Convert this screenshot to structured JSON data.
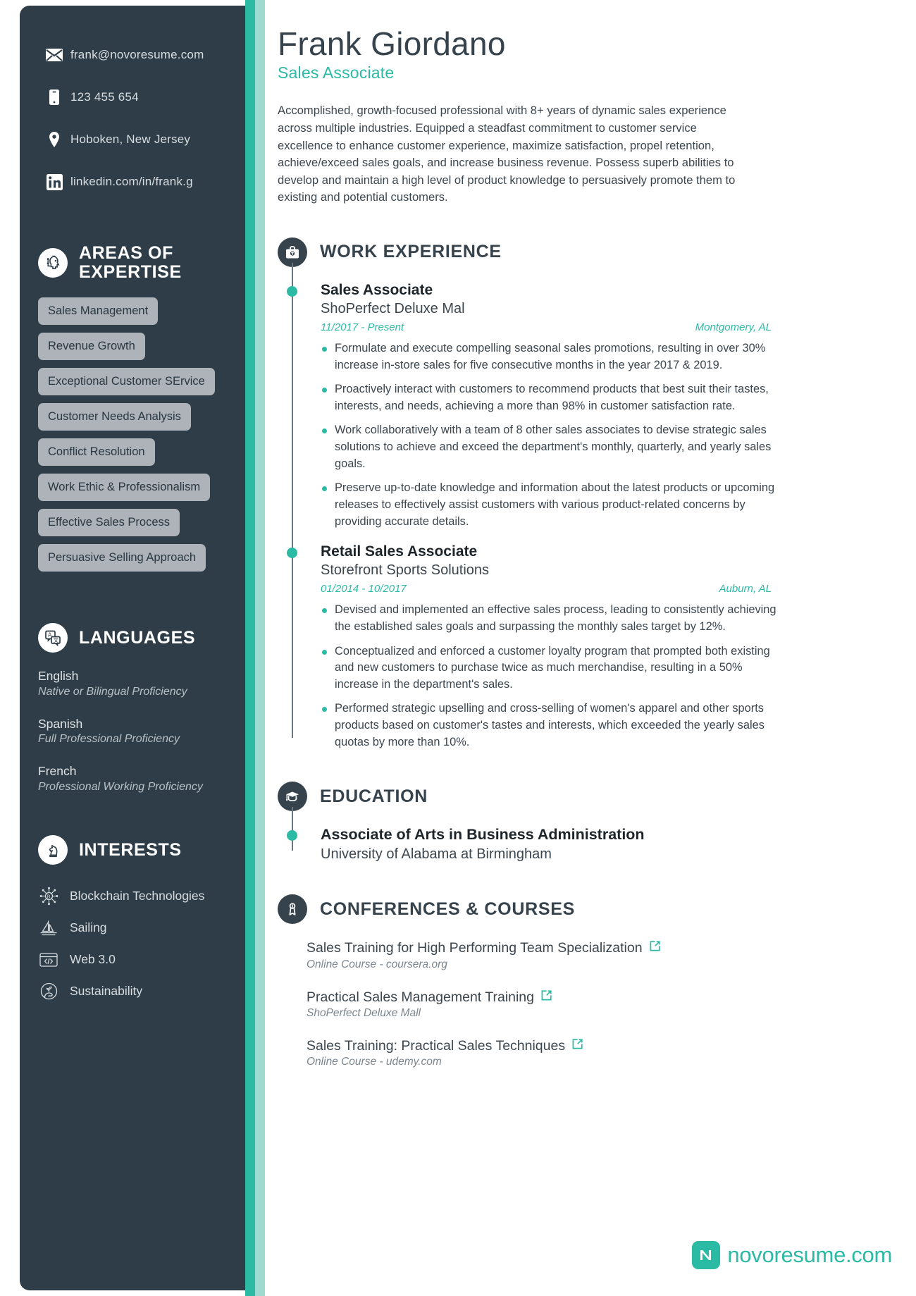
{
  "colors": {
    "accent": "#2bbaa4",
    "accent_light": "#9ddbd1",
    "dark": "#2e3d47",
    "heading": "#36434d"
  },
  "header": {
    "name": "Frank Giordano",
    "role": "Sales Associate",
    "summary": "Accomplished, growth-focused professional with 8+ years of dynamic sales experience across multiple industries. Equipped a steadfast commitment to customer service excellence to enhance customer experience, maximize satisfaction, propel retention, achieve/exceed sales goals, and increase business revenue. Possess superb abilities to develop and maintain a high level of product knowledge to persuasively promote them to existing and potential customers."
  },
  "sidebar": {
    "contacts": [
      {
        "icon": "envelope-icon",
        "value": "frank@novoresume.com"
      },
      {
        "icon": "phone-icon",
        "value": "123 455 654"
      },
      {
        "icon": "location-pin-icon",
        "value": "Hoboken, New Jersey"
      },
      {
        "icon": "linkedin-icon",
        "value": "linkedin.com/in/frank.g"
      }
    ],
    "expertise": {
      "icon": "brain-head-icon",
      "title_line1": "AREAS OF",
      "title_line2": "EXPERTISE",
      "tags": [
        "Sales Management",
        "Revenue Growth",
        "Exceptional Customer SErvice",
        "Customer Needs Analysis",
        "Conflict Resolution",
        "Work Ethic & Professionalism",
        "Effective Sales Process",
        "Persuasive Selling Approach"
      ]
    },
    "languages": {
      "icon": "translate-icon",
      "title": "LANGUAGES",
      "items": [
        {
          "name": "English",
          "level": "Native or Bilingual Proficiency"
        },
        {
          "name": "Spanish",
          "level": "Full Professional Proficiency"
        },
        {
          "name": "French",
          "level": "Professional Working Proficiency"
        }
      ]
    },
    "interests": {
      "icon": "chess-knight-icon",
      "title": "INTERESTS",
      "items": [
        {
          "icon": "blockchain-icon",
          "label": "Blockchain Technologies"
        },
        {
          "icon": "sailboat-icon",
          "label": "Sailing"
        },
        {
          "icon": "browser-code-icon",
          "label": "Web 3.0"
        },
        {
          "icon": "hand-plant-icon",
          "label": "Sustainability"
        }
      ]
    }
  },
  "work": {
    "icon": "briefcase-icon",
    "title": "WORK EXPERIENCE",
    "entries": [
      {
        "title": "Sales Associate",
        "org": "ShoPerfect Deluxe Mal",
        "dates": "11/2017 - Present",
        "location": "Montgomery, AL",
        "bullets": [
          "Formulate and execute compelling seasonal sales promotions, resulting in over 30% increase in-store sales for five consecutive months in the year 2017 & 2019.",
          "Proactively interact with customers to recommend products that best suit their tastes, interests, and needs, achieving a more than 98% in customer satisfaction rate.",
          "Work collaboratively with a team of 8 other sales associates to devise strategic sales solutions to achieve and exceed the department's monthly, quarterly, and yearly sales goals.",
          "Preserve up-to-date knowledge and information about the latest products or upcoming releases to effectively assist customers with various product-related concerns by providing accurate details."
        ]
      },
      {
        "title": "Retail Sales Associate",
        "org": "Storefront Sports Solutions",
        "dates": "01/2014 - 10/2017",
        "location": "Auburn, AL",
        "bullets": [
          "Devised and implemented an effective sales process, leading to consistently achieving the established sales goals and surpassing the monthly sales target by 12%.",
          "Conceptualized and enforced a customer loyalty program that prompted both existing and new customers to purchase twice as much merchandise, resulting in a 50% increase in the department's sales.",
          "Performed strategic upselling and cross-selling of women's apparel and other sports products based on customer's tastes and interests, which exceeded the yearly sales quotas by more than 10%."
        ]
      }
    ]
  },
  "education": {
    "icon": "graduation-cap-icon",
    "title": "EDUCATION",
    "entries": [
      {
        "degree": "Associate of Arts in Business Administration",
        "school": "University of Alabama at Birmingham"
      }
    ]
  },
  "conferences": {
    "icon": "certificate-icon",
    "title": "CONFERENCES & COURSES",
    "items": [
      {
        "name": "Sales Training for High Performing Team Specialization",
        "sub": "Online Course - coursera.org"
      },
      {
        "name": "Practical Sales Management Training",
        "sub": "ShoPerfect Deluxe Mall"
      },
      {
        "name": "Sales Training: Practical Sales Techniques",
        "sub": "Online Course - udemy.com"
      }
    ]
  },
  "footer": {
    "logo_text": "novoresume.com",
    "logo_mark": "N"
  }
}
